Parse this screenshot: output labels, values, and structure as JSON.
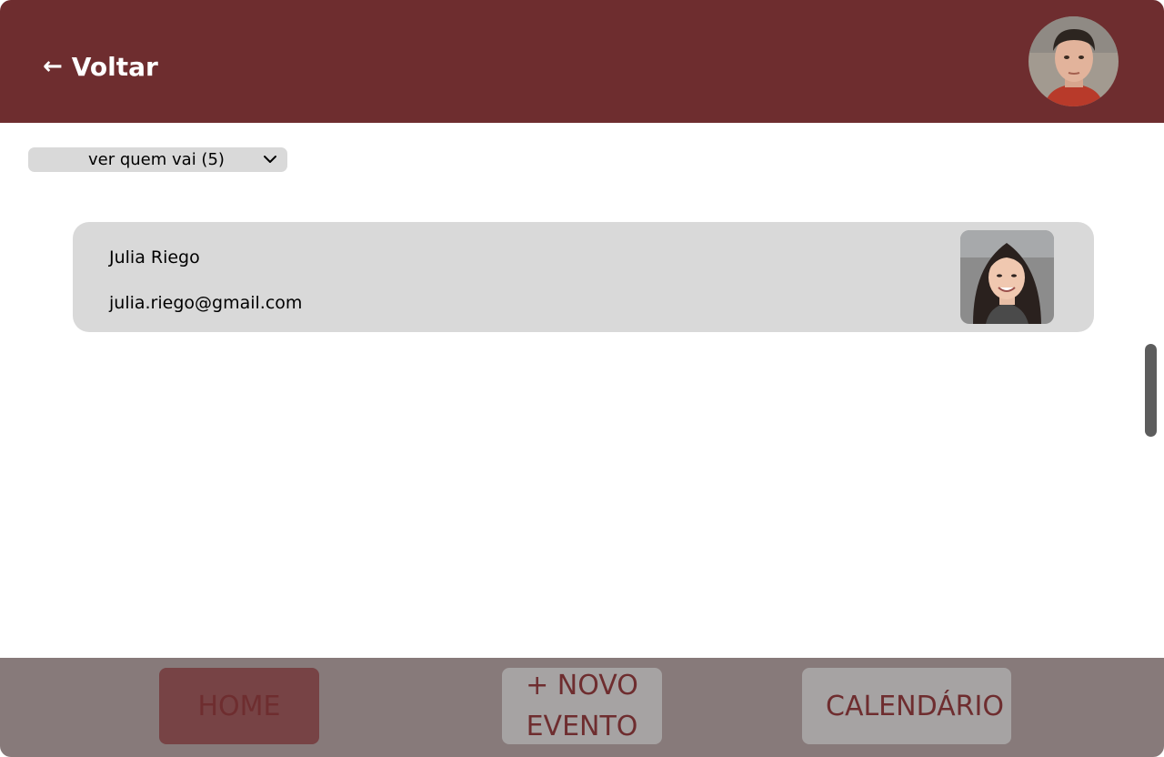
{
  "header": {
    "back_label": "Voltar",
    "back_icon": "arrow-left-icon",
    "background_color": "#6e2d2f",
    "avatar": "user-avatar"
  },
  "attendees": {
    "dropdown_label": "ver quem vai (5)",
    "dropdown_icon": "chevron-down-icon",
    "items": [
      {
        "name": "Julia Riego",
        "email": "julia.riego@gmail.com",
        "photo": "attendee-photo"
      }
    ]
  },
  "bottom_nav": {
    "home_label": "HOME",
    "new_event_label": "+ NOVO EVENTO",
    "calendar_label": "CALENDÁRIO",
    "active": "HOME",
    "text_color": "#6e2d2f",
    "active_color": "#774345",
    "inactive_color": "#a6a3a3"
  }
}
